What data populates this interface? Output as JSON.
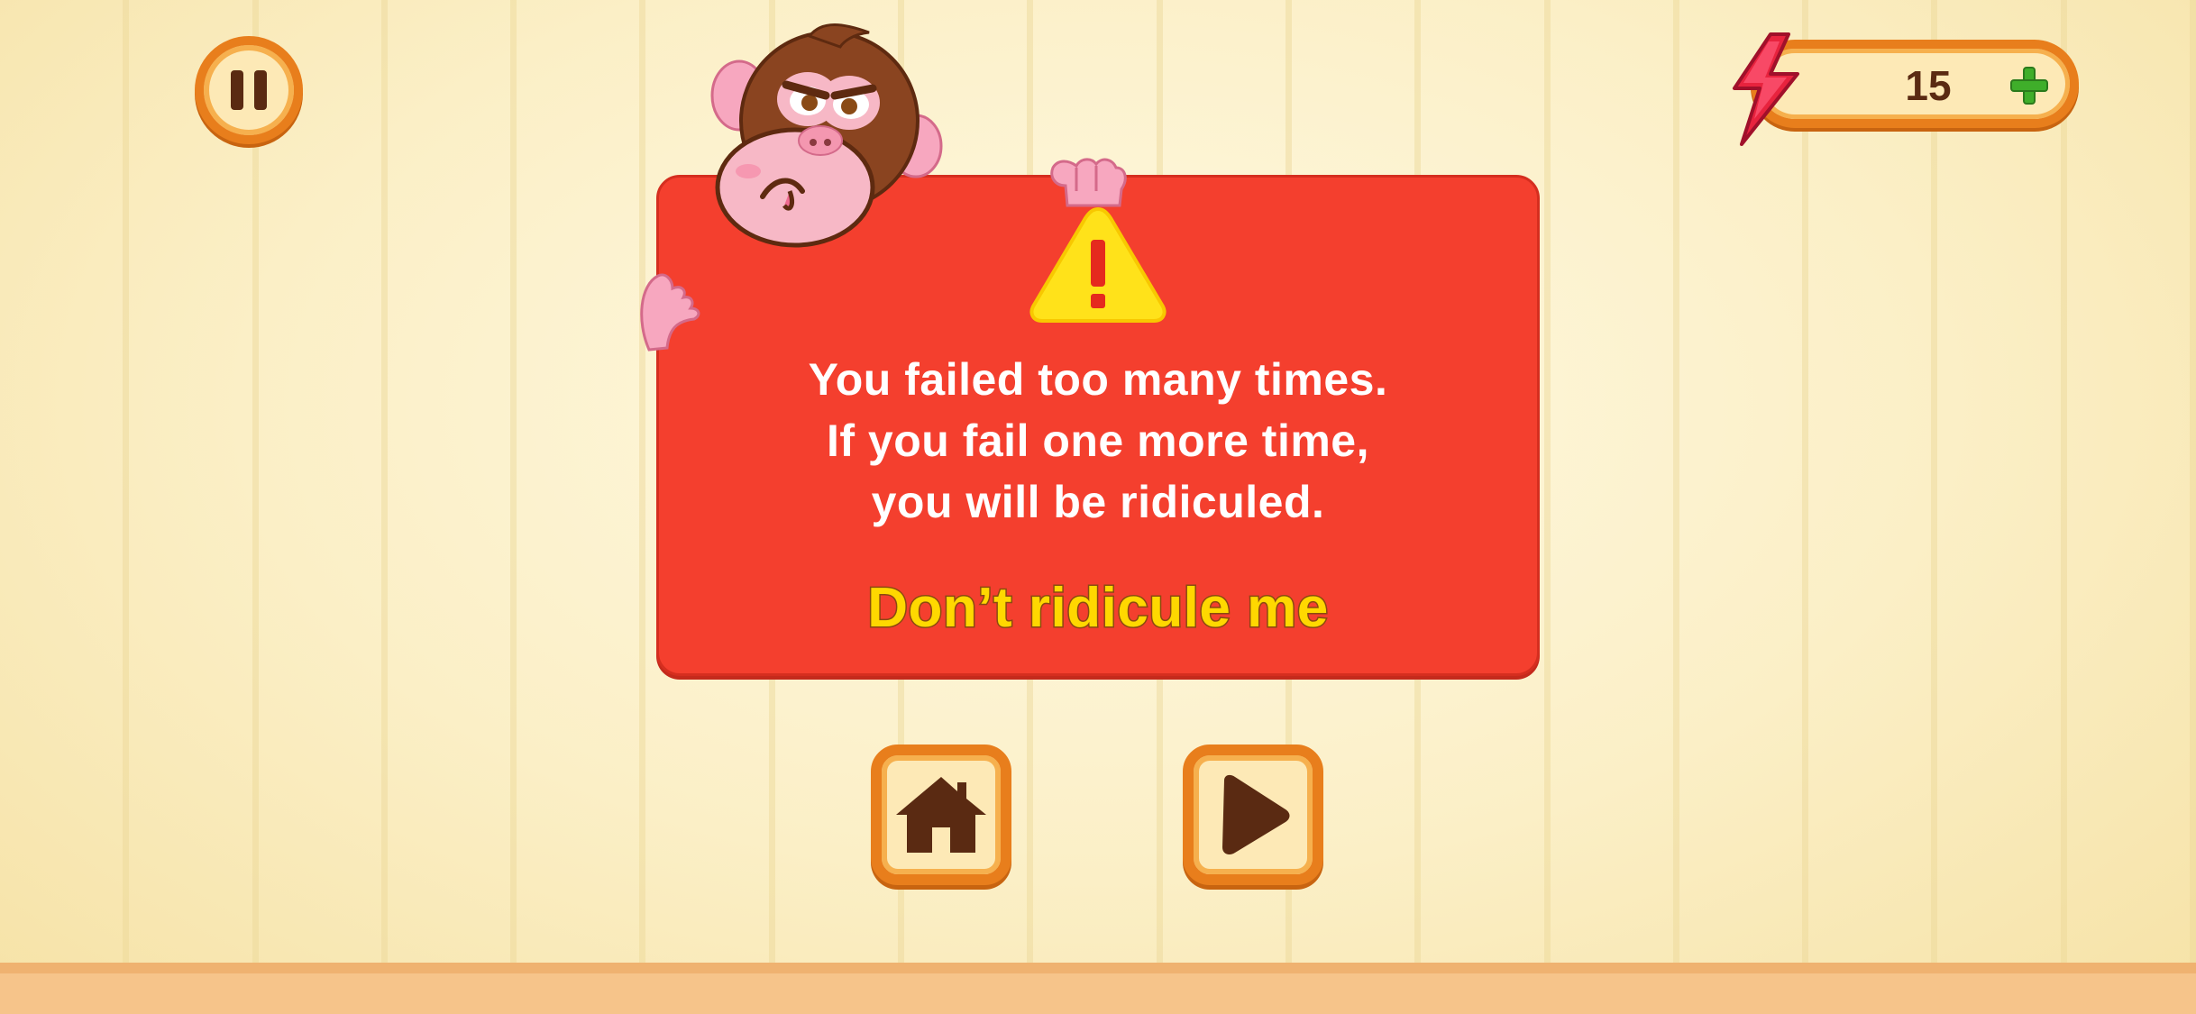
{
  "hud": {
    "energy_count": "15"
  },
  "dialog": {
    "message_lines": [
      "You failed too many times.",
      "If you fail one more time,",
      "you will be ridiculed."
    ],
    "action_label": "Don’t ridicule me"
  },
  "icons": {
    "pause": "pause-icon",
    "energy": "lightning-bolt-icon",
    "add": "plus-icon",
    "warning": "warning-icon",
    "home": "home-icon",
    "play": "play-icon",
    "character": "angry-monkey"
  },
  "colors": {
    "panel": "#f43f2e",
    "action_text": "#ffd800",
    "button_border": "#e87e1c",
    "button_fill": "#fde9b6",
    "icon_dark": "#5a2a12",
    "plus_green": "#3fae2a",
    "bolt_pink": "#e8233e"
  }
}
